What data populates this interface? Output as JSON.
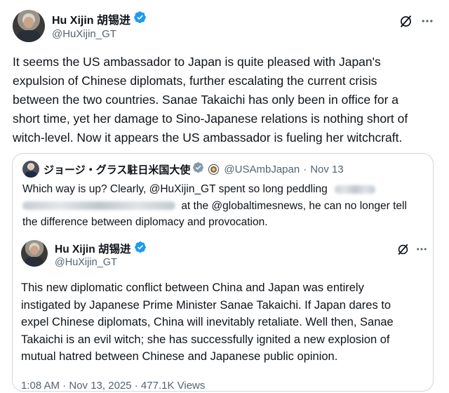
{
  "main_tweet": {
    "display_name": "Hu Xijin 胡锡进",
    "handle": "@HuXijin_GT",
    "text_lines": [
      "It seems the US ambassador to Japan is quite pleased with Japan's",
      "expulsion of Chinese diplomats, further escalating the current crisis",
      "between the two countries. Sanae Takaichi has only been in office for a",
      "short time, yet her damage to Sino-Japanese relations is nothing short of",
      "witch-level. Now it appears the US ambassador is fueling her witchcraft."
    ]
  },
  "quoted_tweet": {
    "display_name": "ジョージ・グラス駐日米国大使",
    "handle": "@USAmbJapan",
    "separator": "·",
    "date": "Nov 13",
    "line1_text": "Which way is up? Clearly, @HuXijin_GT spent so long peddling",
    "line2_text": "at the @globaltimesnews, he can no longer tell",
    "line3_text": "the difference between diplomacy and provocation."
  },
  "inner_tweet": {
    "display_name": "Hu Xijin 胡锡进",
    "handle": "@HuXijin_GT",
    "text_lines": [
      "This new diplomatic conflict between China and Japan was entirely",
      "instigated by Japanese Prime Minister Sanae Takaichi. If Japan dares to",
      "expel Chinese diplomats, China will inevitably retaliate. Well then, Sanae",
      "Takaichi is an evil witch; she has successfully ignited a new explosion of",
      "mutual hatred between Chinese and Japanese public opinion."
    ],
    "meta_partial": "1:08 AM · Nov 13, 2025 · 477.1K Views"
  },
  "icons": {
    "verified": "verified-badge-icon",
    "grok": "grok-icon",
    "more": "more-options-icon",
    "affiliation": "government-affiliation-icon"
  },
  "colors": {
    "verified_blue": "#1d9bf0",
    "text_primary": "#0f1419",
    "text_secondary": "#536471",
    "border": "#cfd9de",
    "gov_badge": "#829aab"
  }
}
